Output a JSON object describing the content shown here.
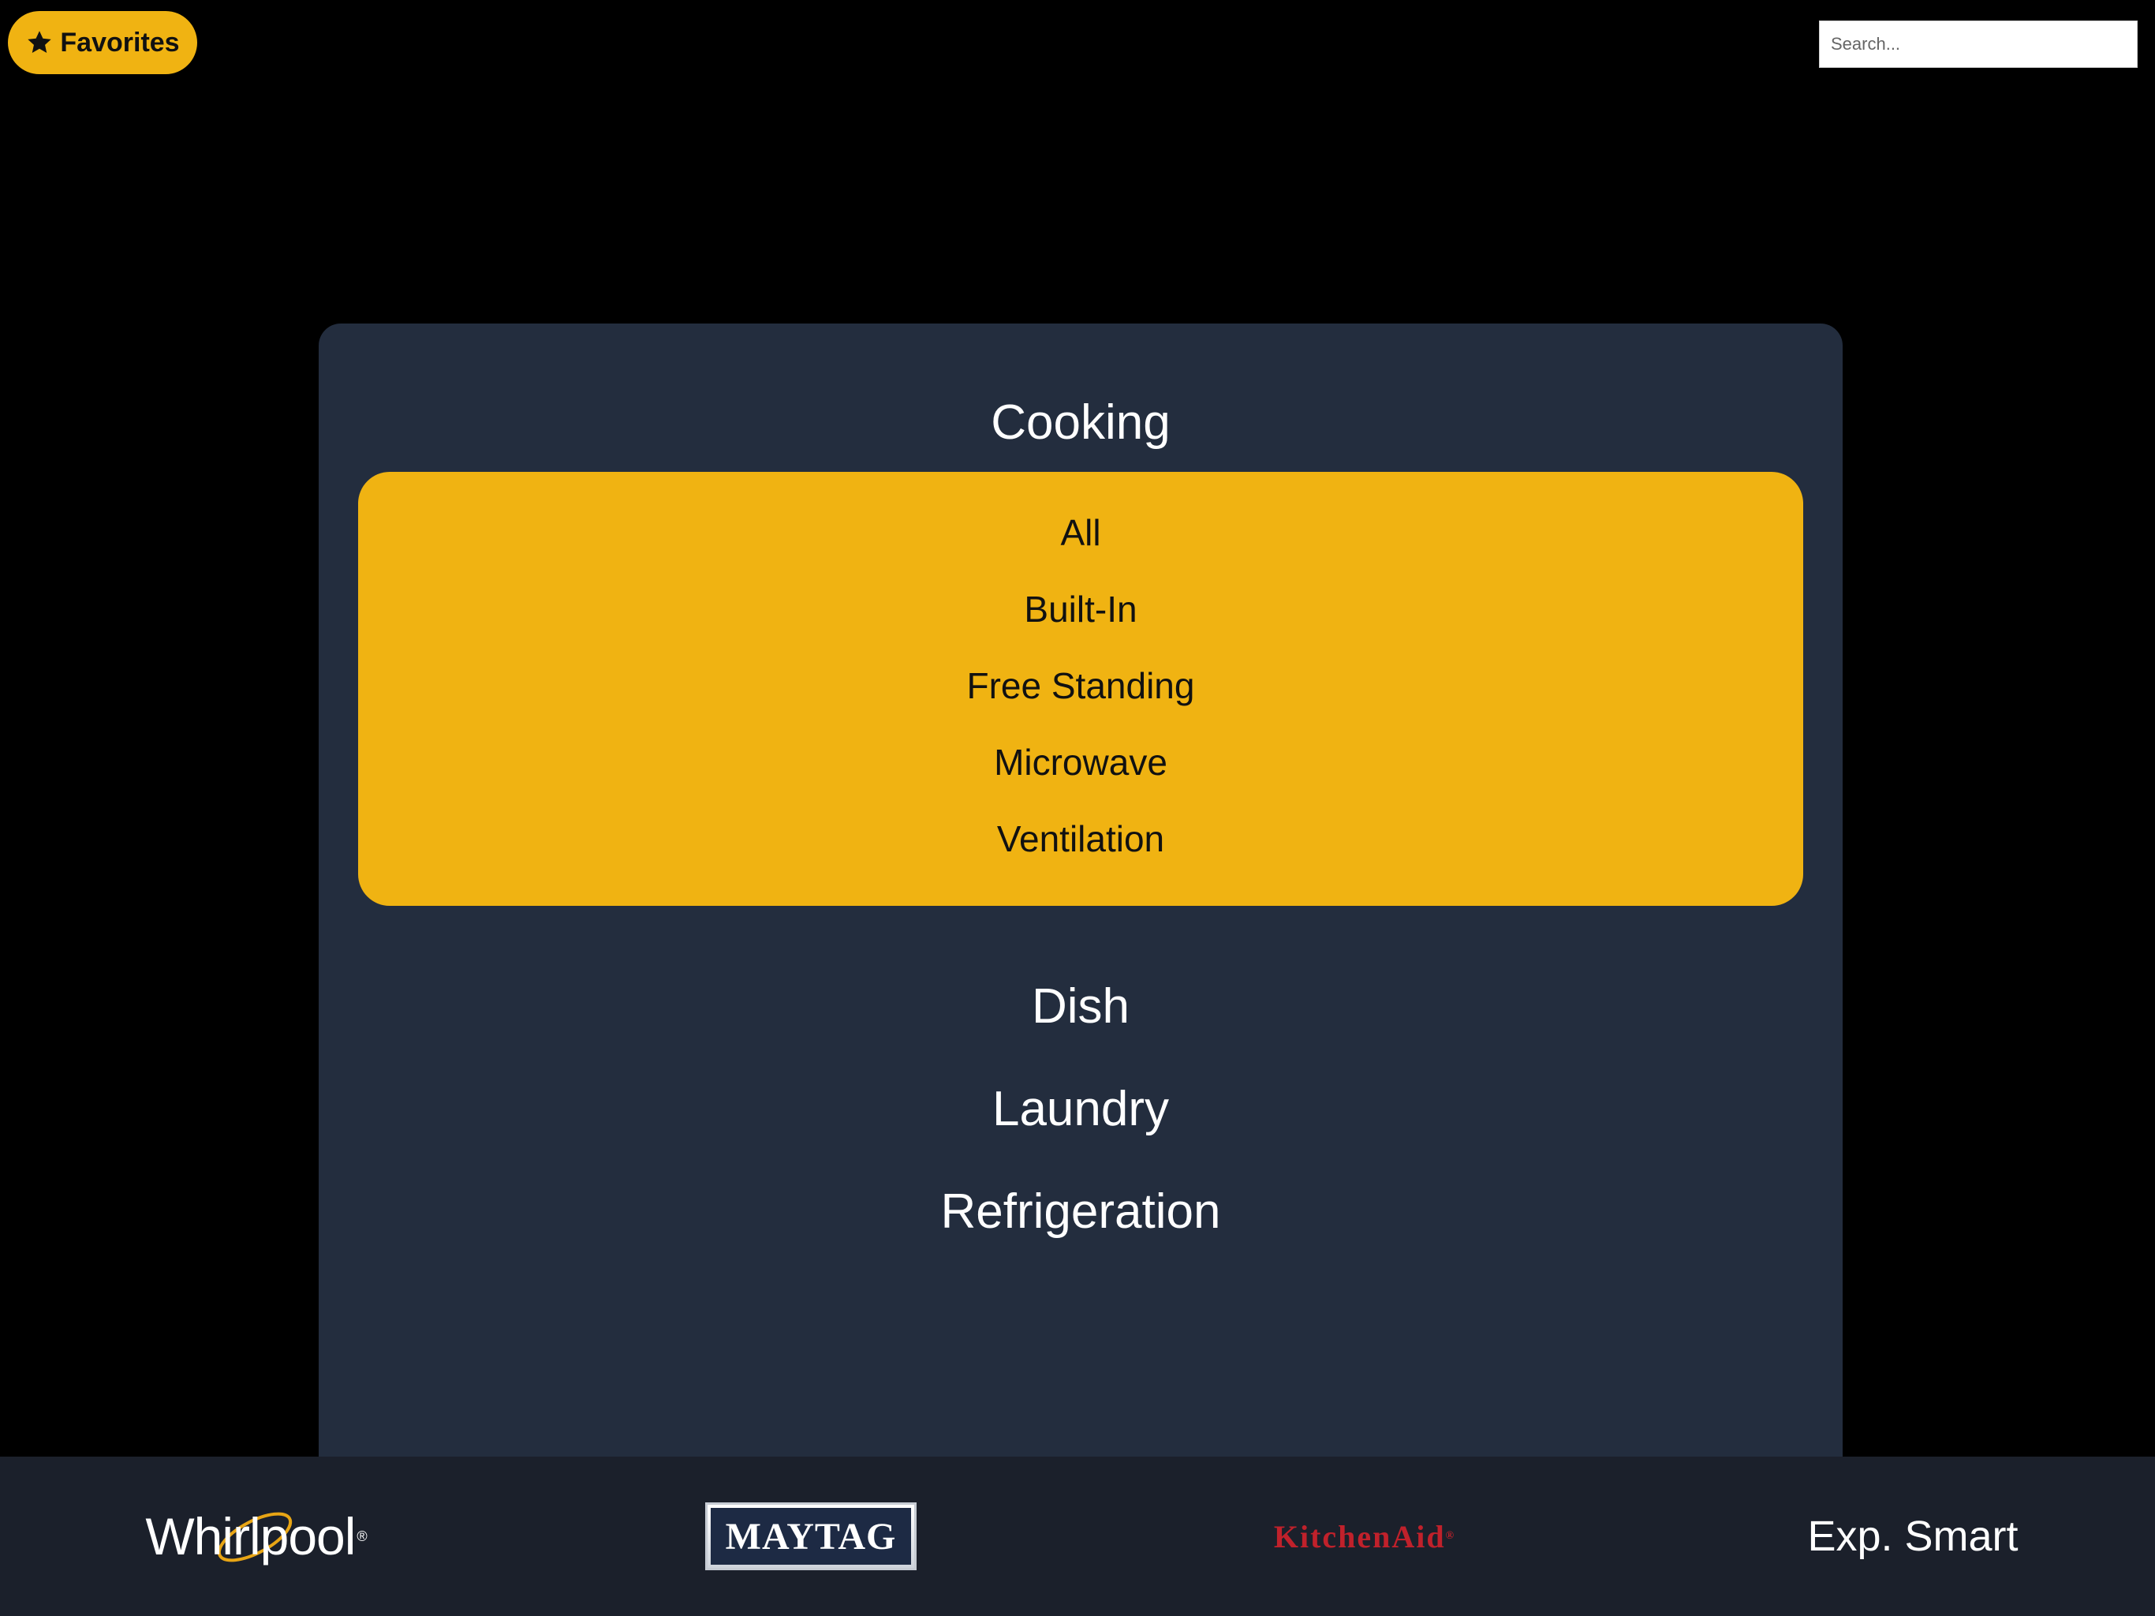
{
  "header": {
    "favorites_label": "Favorites",
    "search_placeholder": "Search..."
  },
  "categories": {
    "cooking": {
      "label": "Cooking",
      "subitems": [
        "All",
        "Built-In",
        "Free Standing",
        "Microwave",
        "Ventilation"
      ]
    },
    "dish": {
      "label": "Dish"
    },
    "laundry": {
      "label": "Laundry"
    },
    "refrigeration": {
      "label": "Refrigeration"
    }
  },
  "brands": {
    "whirlpool": "Whirlpool",
    "maytag": "MAYTAG",
    "kitchenaid": "KitchenAid",
    "expsmart": "Exp. Smart"
  },
  "colors": {
    "accent": "#f0b312",
    "panel": "#232d3e",
    "background": "#000000",
    "brand_bar": "#1b202b",
    "kitchenaid_red": "#c0212b"
  },
  "icons": {
    "favorites": "star-icon"
  }
}
